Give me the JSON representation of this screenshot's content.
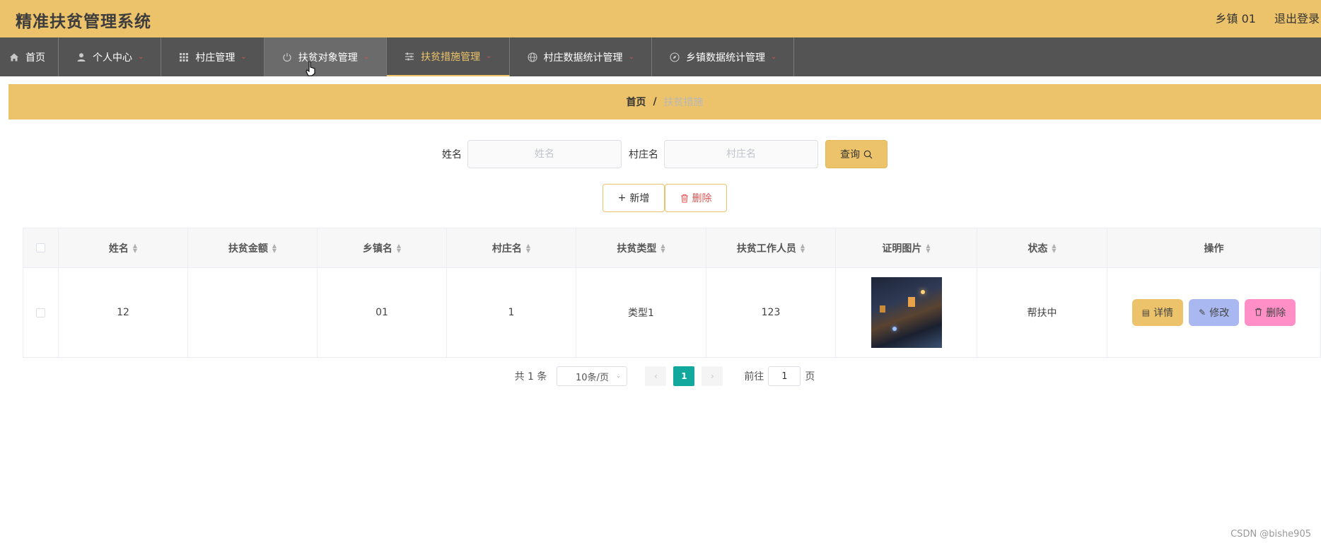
{
  "header": {
    "app_title": "精准扶贫管理系统",
    "user": "乡镇 01",
    "logout": "退出登录"
  },
  "nav": [
    {
      "label": "首页",
      "icon": "home-icon"
    },
    {
      "label": "个人中心",
      "icon": "user-icon"
    },
    {
      "label": "村庄管理",
      "icon": "grid-icon"
    },
    {
      "label": "扶贫对象管理",
      "icon": "power-icon"
    },
    {
      "label": "扶贫措施管理",
      "icon": "sliders-icon"
    },
    {
      "label": "村庄数据统计管理",
      "icon": "globe-icon"
    },
    {
      "label": "乡镇数据统计管理",
      "icon": "compass-icon"
    }
  ],
  "breadcrumb": {
    "home": "首页",
    "sep": "/",
    "current": "扶贫措施"
  },
  "search": {
    "name_label": "姓名",
    "name_placeholder": "姓名",
    "village_label": "村庄名",
    "village_placeholder": "村庄名",
    "query_button": "查询"
  },
  "actions": {
    "add": "新增",
    "delete": "删除"
  },
  "table": {
    "columns": [
      "姓名",
      "扶贫金额",
      "乡镇名",
      "村庄名",
      "扶贫类型",
      "扶贫工作人员",
      "证明图片",
      "状态",
      "操作"
    ],
    "rows": [
      {
        "name": "12",
        "amount": "",
        "town": "01",
        "village": "1",
        "type": "类型1",
        "worker": "123",
        "status": "帮扶中"
      }
    ],
    "row_actions": {
      "detail": "详情",
      "edit": "修改",
      "delete": "删除"
    }
  },
  "pagination": {
    "total": "共 1 条",
    "page_size": "10条/页",
    "current_page": "1",
    "goto_label": "前往",
    "goto_value": "1",
    "page_unit": "页"
  },
  "watermark": "CSDN @bishe905",
  "colors": {
    "accent": "#ecc36a",
    "nav_bg": "#545454",
    "page_active": "#13a89e",
    "edit_btn": "#a9b8f0",
    "delete_btn": "#ff8fc6"
  }
}
